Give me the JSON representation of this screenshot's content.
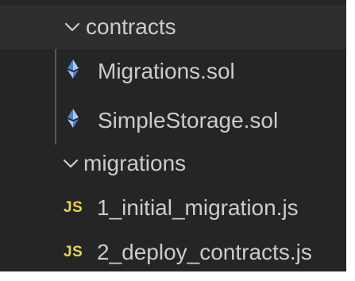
{
  "explorer": {
    "folders": [
      {
        "name": "contracts",
        "expanded": true,
        "chevron_icon": "chevron-down-icon",
        "files": [
          {
            "name": "Migrations.sol",
            "icon": "solidity-icon"
          },
          {
            "name": "SimpleStorage.sol",
            "icon": "solidity-icon"
          }
        ]
      },
      {
        "name": "migrations",
        "expanded": true,
        "chevron_icon": "chevron-down-icon",
        "files": [
          {
            "name": "1_initial_migration.js",
            "icon": "js-icon",
            "icon_text": "JS"
          },
          {
            "name": "2_deploy_contracts.js",
            "icon": "js-icon",
            "icon_text": "JS"
          }
        ]
      }
    ]
  },
  "colors": {
    "background": "#252526",
    "selected_row": "#2e2e30",
    "text": "#cccccc",
    "js_icon": "#e8d44d",
    "solidity_icon_light": "#a9c7ff",
    "solidity_icon_dark": "#4f84c4"
  }
}
